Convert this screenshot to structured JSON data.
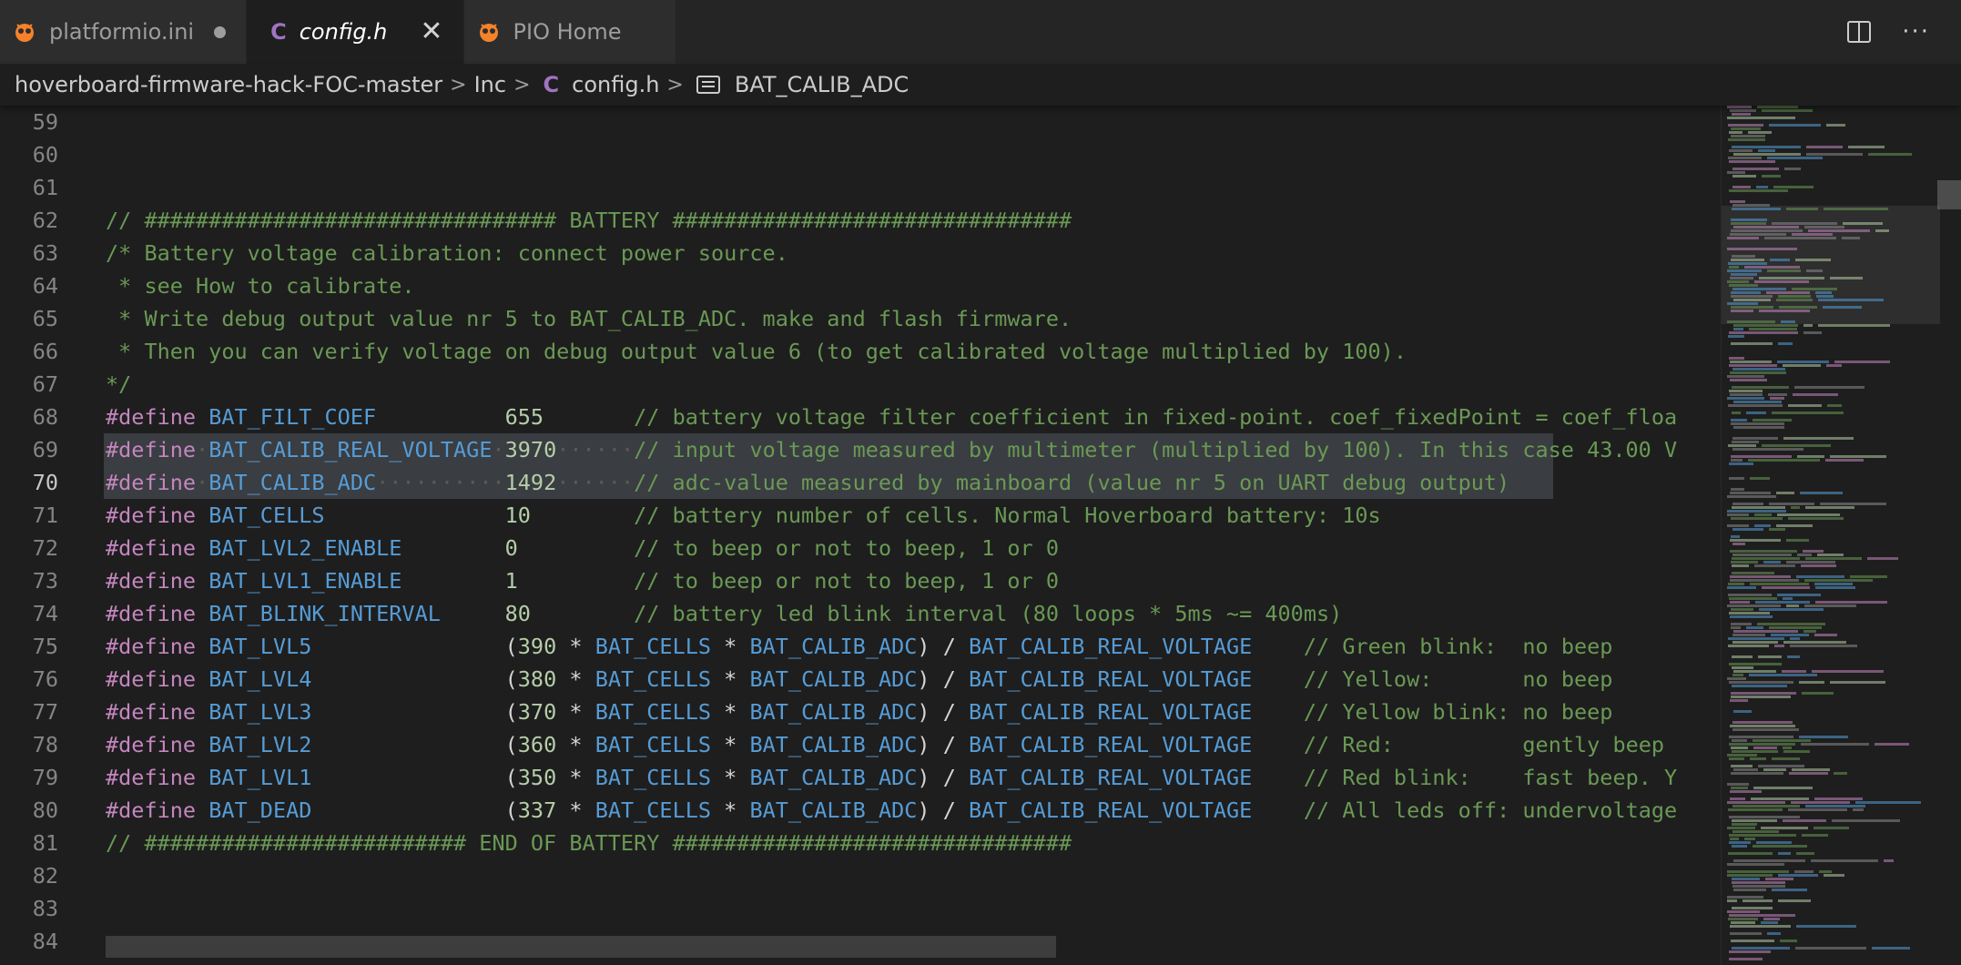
{
  "tabs": [
    {
      "label": "platformio.ini",
      "icon": "platformio-icon",
      "dirty": true
    },
    {
      "label": "config.h",
      "icon": "c-file-icon",
      "active": true
    },
    {
      "label": "PIO Home",
      "icon": "platformio-icon"
    }
  ],
  "breadcrumb": {
    "folder": "hoverboard-firmware-hack-FOC-master",
    "subfolder": "Inc",
    "file": "config.h",
    "symbol": "BAT_CALIB_ADC"
  },
  "editor": {
    "lines": [
      {
        "n": "59",
        "code": ""
      },
      {
        "n": "60",
        "code": ""
      },
      {
        "n": "61",
        "code": ""
      },
      {
        "n": "62",
        "code": "// ################################ BATTERY ###############################"
      },
      {
        "n": "63",
        "code": "/* Battery voltage calibration: connect power source."
      },
      {
        "n": "64",
        "code": " * see How to calibrate."
      },
      {
        "n": "65",
        "code": " * Write debug output value nr 5 to BAT_CALIB_ADC. make and flash firmware."
      },
      {
        "n": "66",
        "code": " * Then you can verify voltage on debug output value 6 (to get calibrated voltage multiplied by 100)."
      },
      {
        "n": "67",
        "code": "*/"
      },
      {
        "n": "68",
        "kw": "#define",
        "name": "BAT_FILT_COEF",
        "pad": "          ",
        "value": "655",
        "vpad": "       ",
        "comment": "// battery voltage filter coefficient in fixed-point. coef_fixedPoint = coef_floa"
      },
      {
        "n": "69",
        "kw": "#define",
        "name": "BAT_CALIB_REAL_VOLTAGE",
        "pad": " ",
        "value": "3970",
        "vpad": "      ",
        "comment": "// input voltage measured by multimeter (multiplied by 100). In this case 43.00 V"
      },
      {
        "n": "70",
        "kw": "#define",
        "name": "BAT_CALIB_ADC",
        "pad": "          ",
        "value": "1492",
        "vpad": "      ",
        "comment": "// adc-value measured by mainboard (value nr 5 on UART debug output)"
      },
      {
        "n": "71",
        "kw": "#define",
        "name": "BAT_CELLS",
        "pad": "              ",
        "value": "10",
        "vpad": "        ",
        "comment": "// battery number of cells. Normal Hoverboard battery: 10s"
      },
      {
        "n": "72",
        "kw": "#define",
        "name": "BAT_LVL2_ENABLE",
        "pad": "        ",
        "value": "0",
        "vpad": "         ",
        "comment": "// to beep or not to beep, 1 or 0"
      },
      {
        "n": "73",
        "kw": "#define",
        "name": "BAT_LVL1_ENABLE",
        "pad": "        ",
        "value": "1",
        "vpad": "         ",
        "comment": "// to beep or not to beep, 1 or 0"
      },
      {
        "n": "74",
        "kw": "#define",
        "name": "BAT_BLINK_INTERVAL",
        "pad": "     ",
        "value": "80",
        "vpad": "        ",
        "comment": "// battery led blink interval (80 loops * 5ms ~= 400ms)"
      },
      {
        "n": "75",
        "kw": "#define",
        "name": "BAT_LVL5",
        "pad": "               ",
        "mult": "390",
        "comment": "// Green blink:  no beep"
      },
      {
        "n": "76",
        "kw": "#define",
        "name": "BAT_LVL4",
        "pad": "               ",
        "mult": "380",
        "comment": "// Yellow:       no beep"
      },
      {
        "n": "77",
        "kw": "#define",
        "name": "BAT_LVL3",
        "pad": "               ",
        "mult": "370",
        "comment": "// Yellow blink: no beep"
      },
      {
        "n": "78",
        "kw": "#define",
        "name": "BAT_LVL2",
        "pad": "               ",
        "mult": "360",
        "comment": "// Red:          gently beep"
      },
      {
        "n": "79",
        "kw": "#define",
        "name": "BAT_LVL1",
        "pad": "               ",
        "mult": "350",
        "comment": "// Red blink:    fast beep. Y"
      },
      {
        "n": "80",
        "kw": "#define",
        "name": "BAT_DEAD",
        "pad": "               ",
        "mult": "337",
        "comment": "// All leds off: undervoltage"
      },
      {
        "n": "81",
        "code": "// ######################### END OF BATTERY ###############################"
      },
      {
        "n": "82",
        "code": ""
      },
      {
        "n": "83",
        "code": ""
      },
      {
        "n": "84",
        "code": ""
      }
    ],
    "formula": {
      "open": "(",
      "star": " * ",
      "cells": "BAT_CELLS",
      "adc": "BAT_CALIB_ADC",
      "close": ")",
      "div": " / ",
      "volt": "BAT_CALIB_REAL_VOLTAGE",
      "gap": "    "
    }
  },
  "colors": {
    "comment": "#6a9955",
    "keyword": "#c586c0",
    "macro": "#569cd6",
    "number": "#b5cea8",
    "background": "#1e1e1e"
  }
}
